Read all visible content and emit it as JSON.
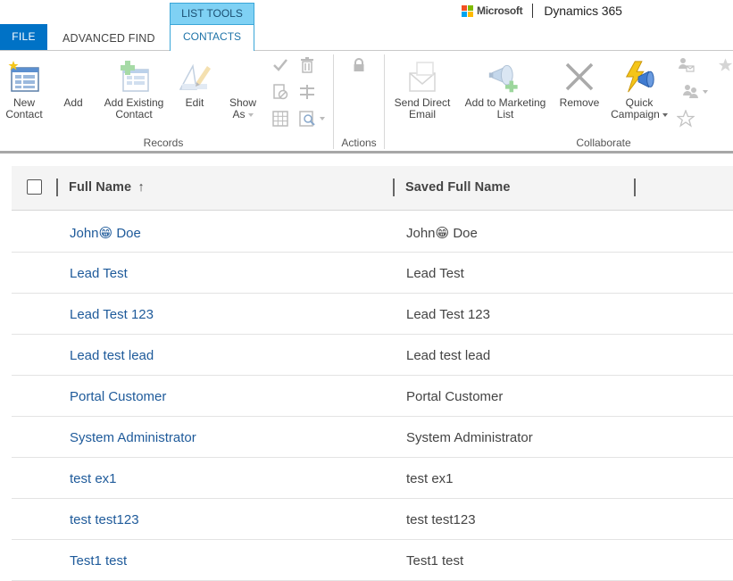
{
  "tabs": {
    "file": "FILE",
    "advanced_find": "ADVANCED FIND",
    "list_tools": "LIST TOOLS",
    "contacts": "CONTACTS"
  },
  "brand": {
    "microsoft": "Microsoft",
    "product": "Dynamics 365",
    "logo_colors": [
      "#f25022",
      "#7fba00",
      "#00a4ef",
      "#ffb900"
    ]
  },
  "ribbon": {
    "records": {
      "label": "Records",
      "new_contact": "New\nContact",
      "add": "Add",
      "add_existing_contact": "Add Existing\nContact",
      "edit": "Edit",
      "show_as": "Show\nAs"
    },
    "actions": {
      "label": "Actions"
    },
    "collaborate": {
      "label": "Collaborate",
      "send_direct_email": "Send Direct\nEmail",
      "add_to_marketing_list": "Add to Marketing\nList",
      "remove": "Remove",
      "quick_campaign": "Quick\nCampaign"
    }
  },
  "grid": {
    "columns": [
      "Full Name",
      "Saved Full Name"
    ],
    "sort_indicator": "↑",
    "rows": [
      {
        "full_name": "John😁 Doe",
        "saved_full_name": "John😁 Doe"
      },
      {
        "full_name": "Lead Test",
        "saved_full_name": "Lead Test"
      },
      {
        "full_name": "Lead Test 123",
        "saved_full_name": "Lead Test 123"
      },
      {
        "full_name": "Lead test lead",
        "saved_full_name": "Lead test lead"
      },
      {
        "full_name": "Portal Customer",
        "saved_full_name": "Portal Customer"
      },
      {
        "full_name": "System Administrator",
        "saved_full_name": "System Administrator"
      },
      {
        "full_name": "test ex1",
        "saved_full_name": "test ex1"
      },
      {
        "full_name": "test test123",
        "saved_full_name": "test test123"
      },
      {
        "full_name": "Test1 test",
        "saved_full_name": "Test1 test"
      }
    ]
  },
  "colors": {
    "file_tab": "#0072c6",
    "list_tools_tab": "#7fd1f4",
    "link": "#1e5a9a"
  }
}
